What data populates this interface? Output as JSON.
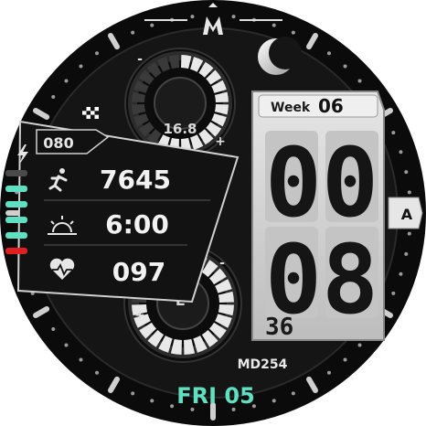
{
  "brand": {
    "logo_text": "M",
    "model": "MD254"
  },
  "week": {
    "label": "Week",
    "number": "06"
  },
  "time": {
    "hours": "00",
    "minutes": "08",
    "seconds": "36"
  },
  "date": {
    "text": "FRI 05"
  },
  "upper_dial": {
    "value": "16.8",
    "plus_label": "+",
    "minus_label": "-",
    "level": 0.55
  },
  "lower_dial": {
    "label": "L",
    "plus_label": "+",
    "minus_label": "-",
    "level": 0.75
  },
  "battery": {
    "value": "080"
  },
  "stats": {
    "steps": "7645",
    "sunrise": "6:00",
    "heart_rate": "097"
  },
  "side_button": {
    "label": "A"
  },
  "colors": {
    "accent": "#5fe0c0",
    "warning": "#e02020",
    "dial_bg": "#111111",
    "lcd_bg": "#d9d9d9"
  },
  "level_bars": [
    "off",
    "on",
    "on",
    "on",
    "on",
    "warn"
  ]
}
